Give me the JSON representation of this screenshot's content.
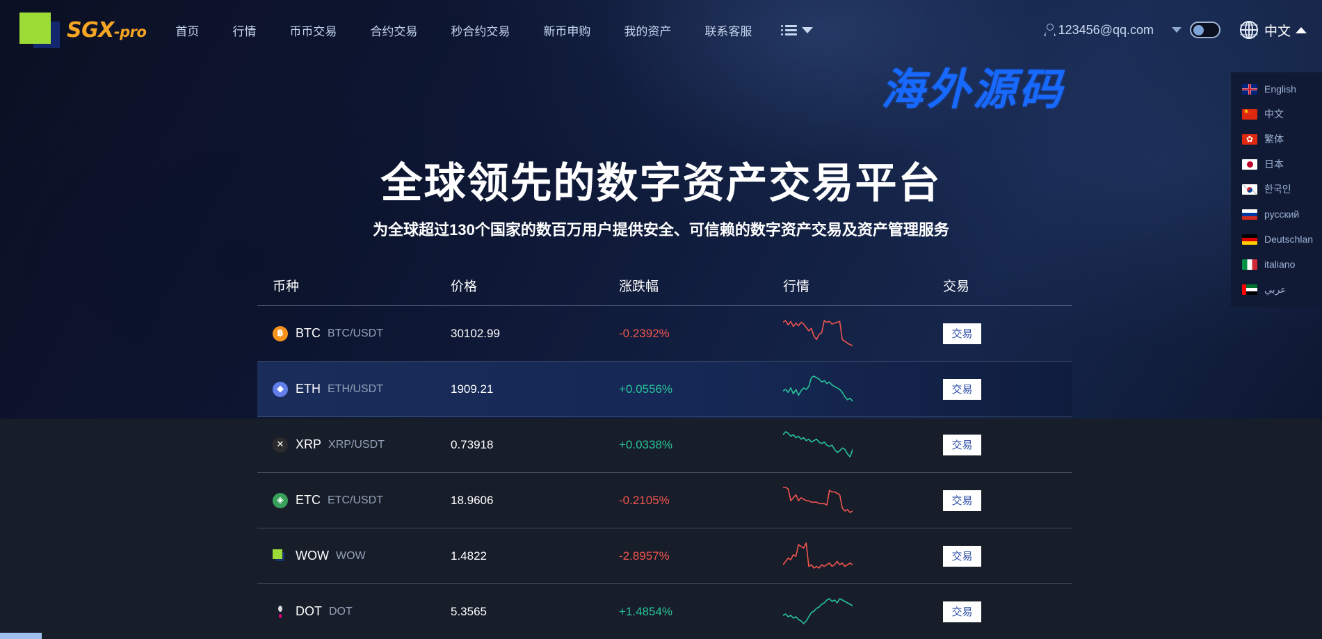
{
  "brand": {
    "logo_text": "SGX",
    "logo_suffix": "-pro"
  },
  "nav": {
    "items": [
      {
        "label": "首页"
      },
      {
        "label": "行情"
      },
      {
        "label": "币币交易"
      },
      {
        "label": "合约交易"
      },
      {
        "label": "秒合约交易"
      },
      {
        "label": "新币申购"
      },
      {
        "label": "我的资产"
      },
      {
        "label": "联系客服"
      }
    ],
    "menu_icon": "list-menu-icon"
  },
  "account": {
    "email": "123456@qq.com",
    "user_icon": "user-icon",
    "dropdown_icon": "caret-down-icon",
    "theme_toggle": "toggle-switch"
  },
  "language": {
    "globe_icon": "globe-icon",
    "current": "中文",
    "caret": "caret-up-icon",
    "options": [
      {
        "label": "English",
        "flag": "flag-uk"
      },
      {
        "label": "中文",
        "flag": "flag-china"
      },
      {
        "label": "繁体",
        "flag": "flag-hongkong"
      },
      {
        "label": "日本",
        "flag": "flag-japan"
      },
      {
        "label": "한국인",
        "flag": "flag-korea"
      },
      {
        "label": "русский",
        "flag": "flag-russia"
      },
      {
        "label": "Deutschlan",
        "flag": "flag-germany"
      },
      {
        "label": "italiano",
        "flag": "flag-italy"
      },
      {
        "label": "عربي",
        "flag": "flag-uae"
      }
    ]
  },
  "watermark": {
    "text": "海外源码",
    "color": "#1769ff"
  },
  "hero": {
    "title": "全球领先的数字资产交易平台",
    "subtitle": "为全球超过130个国家的数百万用户提供安全、可信赖的数字资产交易及资产管理服务"
  },
  "market": {
    "headers": {
      "coin": "币种",
      "price": "价格",
      "change": "涨跌幅",
      "chart": "行情",
      "trade": "交易"
    },
    "trade_label": "交易",
    "colors": {
      "up": "#27c49a",
      "down": "#f0554e",
      "button_bg": "#ffffff",
      "button_text": "#2d4ea8"
    },
    "rows": [
      {
        "symbol": "BTC",
        "pair": "BTC/USDT",
        "price": "30102.99",
        "change": "-0.2392%",
        "direction": "down",
        "icon": "btc-coin-icon",
        "icon_glyph": "฿",
        "sparkline": [
          14,
          12,
          17,
          13,
          19,
          15,
          18,
          14,
          16,
          20,
          24,
          21,
          30,
          34,
          28,
          26,
          12,
          14,
          13,
          16,
          15,
          14,
          13,
          34,
          36,
          38,
          40,
          41
        ]
      },
      {
        "symbol": "ETH",
        "pair": "ETH/USDT",
        "price": "1909.21",
        "change": "+0.0556%",
        "direction": "up",
        "icon": "eth-coin-icon",
        "icon_glyph": "◆",
        "highlighted": true,
        "sparkline": [
          26,
          24,
          28,
          22,
          30,
          24,
          32,
          26,
          22,
          24,
          20,
          8,
          6,
          8,
          10,
          14,
          12,
          16,
          14,
          18,
          20,
          22,
          24,
          28,
          34,
          38,
          36,
          40
        ]
      },
      {
        "symbol": "XRP",
        "pair": "XRP/USDT",
        "price": "0.73918",
        "change": "+0.0338%",
        "direction": "up",
        "icon": "xrp-coin-icon",
        "icon_glyph": "✕",
        "sparkline": [
          10,
          6,
          8,
          12,
          10,
          14,
          12,
          16,
          14,
          18,
          16,
          20,
          18,
          16,
          20,
          22,
          20,
          24,
          26,
          24,
          30,
          34,
          32,
          28,
          30,
          36,
          40,
          30
        ]
      },
      {
        "symbol": "ETC",
        "pair": "ETC/USDT",
        "price": "18.9606",
        "change": "-0.2105%",
        "direction": "down",
        "icon": "etc-coin-icon",
        "icon_glyph": "◈",
        "sparkline": [
          8,
          8,
          10,
          26,
          22,
          18,
          26,
          22,
          24,
          26,
          26,
          28,
          28,
          28,
          30,
          30,
          30,
          32,
          12,
          14,
          14,
          16,
          18,
          36,
          40,
          38,
          42,
          40
        ]
      },
      {
        "symbol": "WOW",
        "pair": "WOW",
        "price": "1.4822",
        "change": "-2.8957%",
        "direction": "down",
        "icon": "wow-coin-icon",
        "icon_glyph": "",
        "sparkline": [
          30,
          26,
          22,
          24,
          18,
          20,
          6,
          8,
          10,
          4,
          32,
          30,
          34,
          32,
          34,
          30,
          32,
          30,
          28,
          32,
          30,
          26,
          30,
          28,
          32,
          30,
          28,
          30
        ]
      },
      {
        "symbol": "DOT",
        "pair": "DOT",
        "price": "5.3565",
        "change": "+1.4854%",
        "direction": "up",
        "icon": "dot-coin-icon",
        "icon_glyph": "",
        "sparkline": [
          28,
          26,
          30,
          28,
          32,
          30,
          34,
          36,
          40,
          36,
          30,
          24,
          22,
          18,
          16,
          12,
          10,
          6,
          4,
          8,
          6,
          10,
          4,
          6,
          8,
          10,
          12,
          14
        ]
      }
    ]
  }
}
